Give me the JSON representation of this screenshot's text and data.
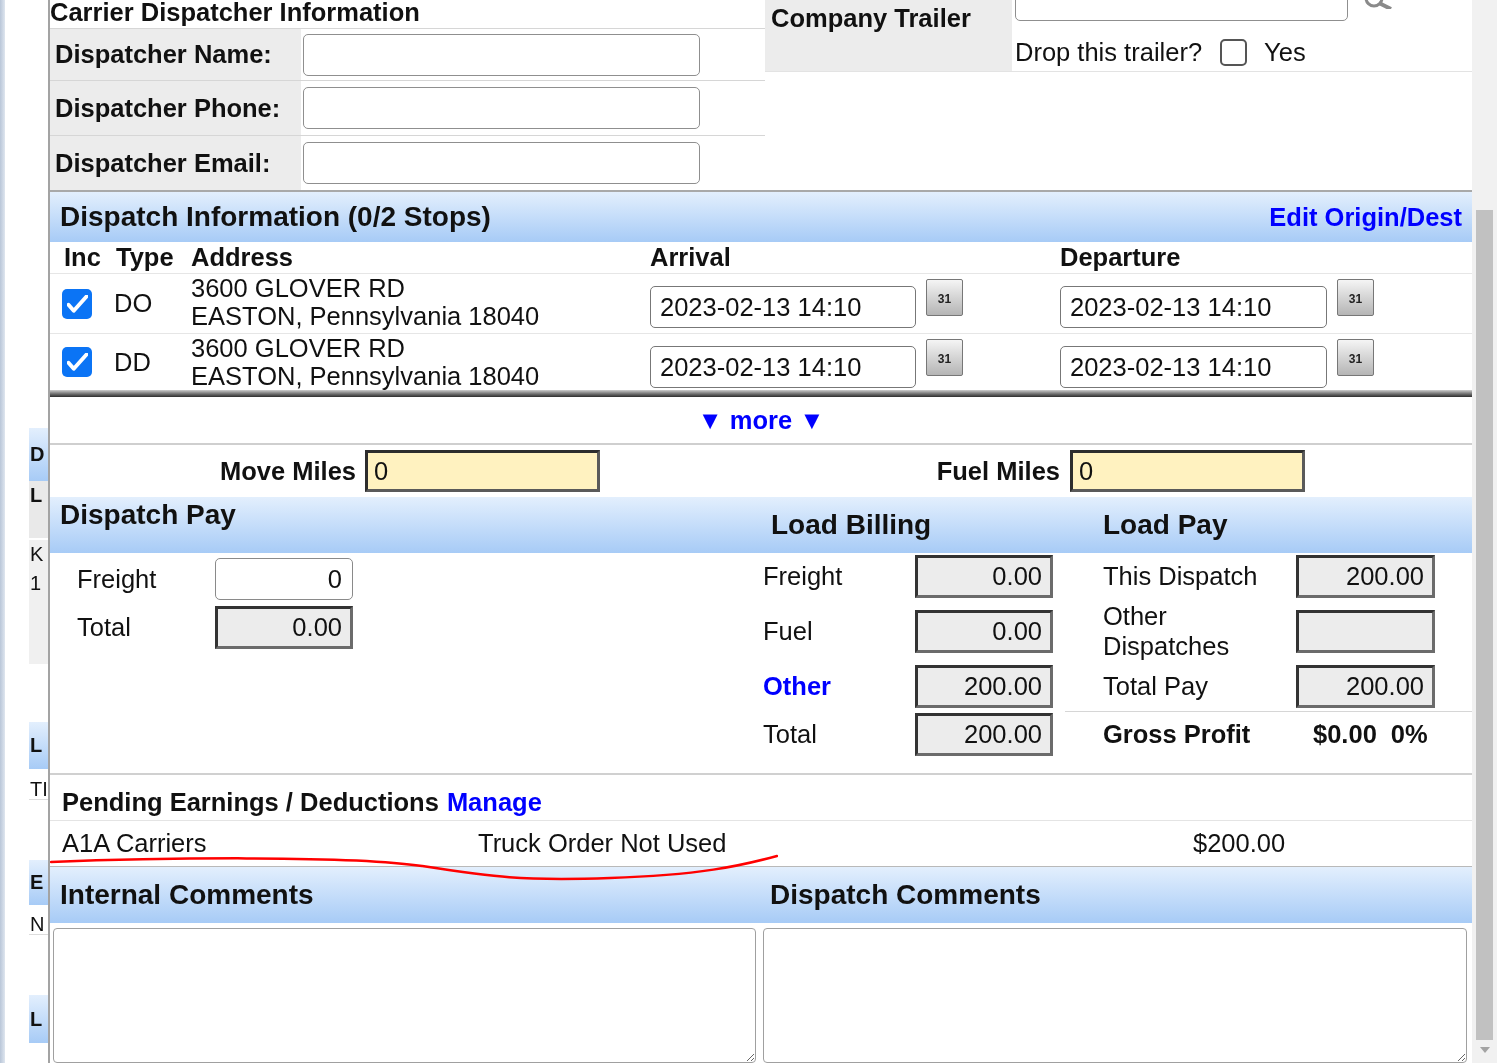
{
  "background_page": [
    {
      "kind": "band",
      "lines": [
        "D"
      ]
    },
    {
      "kind": "label",
      "lines": [
        "L"
      ]
    },
    {
      "kind": "shaded",
      "lines": [
        "K",
        "1"
      ]
    },
    {
      "kind": "band",
      "lines": [
        "L"
      ]
    },
    {
      "kind": "plain",
      "lines": [
        "TI"
      ]
    },
    {
      "kind": "band",
      "lines": [
        "E"
      ]
    },
    {
      "kind": "plain",
      "lines": [
        "N"
      ]
    },
    {
      "kind": "band",
      "lines": [
        "L"
      ]
    }
  ],
  "carrier_dispatcher": {
    "title": "Carrier Dispatcher Information",
    "fields": [
      {
        "label": "Dispatcher Name:"
      },
      {
        "label": "Dispatcher Phone:"
      },
      {
        "label": "Dispatcher Email:"
      }
    ]
  },
  "company_trailer": {
    "label": "Company Trailer",
    "drop_question": "Drop this trailer?",
    "drop_checked": false,
    "drop_option": "Yes"
  },
  "dispatch_information": {
    "title": "Dispatch Information (0/2 Stops)",
    "edit_link": "Edit Origin/Dest",
    "columns": [
      "Inc",
      "Type",
      "Address",
      "Arrival",
      "Departure"
    ],
    "stops": [
      {
        "included": true,
        "type": "DO",
        "address_line1": "3600 GLOVER RD",
        "address_line2": "EASTON, Pennsylvania 18040",
        "arrival": "2023-02-13 14:10",
        "arrival_calendar": "31",
        "departure": "2023-02-13 14:10",
        "departure_calendar": "31"
      },
      {
        "included": true,
        "type": "DD",
        "address_line1": "3600 GLOVER RD",
        "address_line2": "EASTON, Pennsylvania 18040",
        "arrival": "2023-02-13 14:10",
        "arrival_calendar": "31",
        "departure": "2023-02-13 14:10",
        "departure_calendar": "31"
      }
    ],
    "more_toggle": "▼ more ▼"
  },
  "miles": [
    {
      "label": "Move Miles",
      "value": "0"
    },
    {
      "label": "Fuel Miles",
      "value": "0"
    }
  ],
  "dispatch_pay": {
    "title": "Dispatch Pay",
    "rows": [
      {
        "label": "Freight",
        "value": "0",
        "readonly": false
      },
      {
        "label": "Total",
        "value": "0.00",
        "readonly": true
      }
    ]
  },
  "load_billing": {
    "title": "Load Billing",
    "rows": [
      {
        "kind": "text",
        "label": "Freight",
        "value": "0.00"
      },
      {
        "kind": "text",
        "label": "Fuel",
        "value": "0.00"
      },
      {
        "kind": "link",
        "label": "Other",
        "value": "200.00"
      },
      {
        "kind": "text",
        "label": "Total",
        "value": "200.00"
      }
    ]
  },
  "load_pay": {
    "title": "Load Pay",
    "rows": [
      {
        "label": "This Dispatch",
        "value": "200.00"
      },
      {
        "label": "Other Dispatches"
      },
      {
        "label": "Total Pay",
        "value": "200.00"
      }
    ],
    "gross_profit": {
      "label": "Gross Profit",
      "amount": "$0.00",
      "percent": "0%"
    }
  },
  "pending": {
    "title": "Pending Earnings / Deductions",
    "manage_link": "Manage",
    "items": [
      {
        "name": "A1A Carriers",
        "description": "Truck Order Not Used",
        "amount": "$200.00"
      }
    ]
  },
  "comments": [
    {
      "title": "Internal Comments"
    },
    {
      "title": "Dispatch Comments"
    }
  ]
}
